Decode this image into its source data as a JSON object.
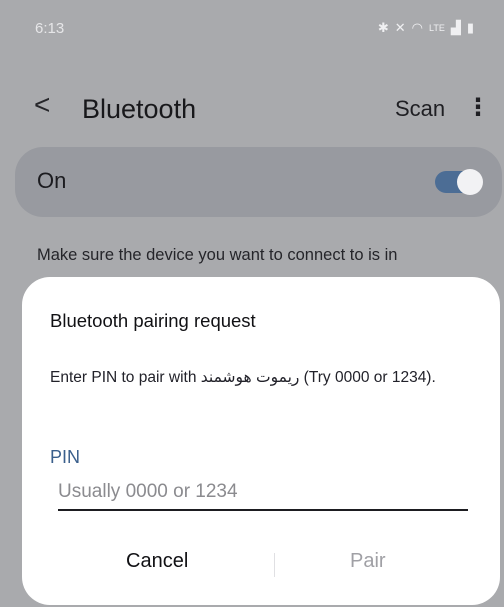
{
  "status_bar": {
    "time": "6:13",
    "icons": [
      "bluetooth-icon",
      "mute-icon",
      "wifi-icon",
      "volte-icon",
      "signal-icon",
      "battery-icon"
    ]
  },
  "header": {
    "title": "Bluetooth",
    "scan_label": "Scan",
    "more": "⋮"
  },
  "bluetooth_toggle": {
    "label": "On",
    "state": "on"
  },
  "hint_text": "Make sure the device you want to connect to is in",
  "dialog": {
    "title": "Bluetooth pairing request",
    "message": "Enter PIN to pair with ریموت هوشمند (Try 0000 or 1234).",
    "pin_label": "PIN",
    "pin_placeholder": "Usually 0000 or 1234",
    "cancel_label": "Cancel",
    "pair_label": "Pair"
  },
  "colors": {
    "accent": "#3a5f8c",
    "toggle_on": "#4c6d95",
    "dim_background": "#a9aaad"
  }
}
